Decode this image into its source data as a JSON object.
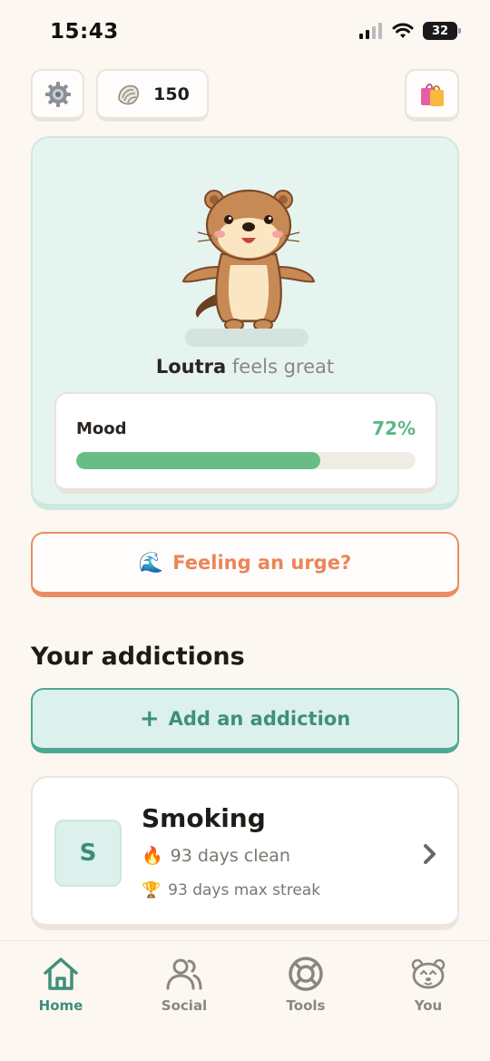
{
  "status_bar": {
    "time": "15:43",
    "battery": "32"
  },
  "top_bar": {
    "shells_count": "150",
    "settings_icon": "gear-icon",
    "shells_icon": "shell-icon",
    "shop_icon": "shopping-bag-icon"
  },
  "pet": {
    "name": "Loutra",
    "status": "feels great",
    "mood_label": "Mood",
    "mood_value": "72%",
    "mood_fraction": 0.72
  },
  "urge_button": {
    "emoji": "🌊",
    "label": "Feeling an urge?"
  },
  "addictions": {
    "title": "Your addictions",
    "add_plus": "+",
    "add_label": "Add an addiction",
    "items": [
      {
        "badge_letter": "S",
        "name": "Smoking",
        "streak_emoji": "🔥",
        "streak_text": "93 days clean",
        "max_emoji": "🏆",
        "max_text": "93 days max streak"
      }
    ]
  },
  "nav": {
    "items": [
      {
        "label": "Home",
        "icon": "home-icon",
        "active": true
      },
      {
        "label": "Social",
        "icon": "people-icon",
        "active": false
      },
      {
        "label": "Tools",
        "icon": "lifebuoy-icon",
        "active": false
      },
      {
        "label": "You",
        "icon": "otter-face-icon",
        "active": false
      }
    ]
  },
  "colors": {
    "accent_teal": "#3f8f7d",
    "mood_green": "#68bd87",
    "urge_orange": "#eb8558",
    "background": "#fcf7f1"
  }
}
